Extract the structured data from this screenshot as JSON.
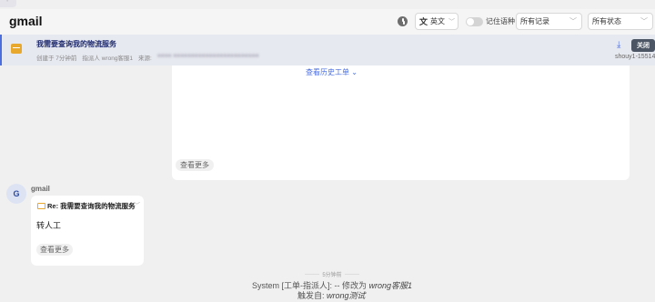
{
  "header": {
    "title": "gmail",
    "language": "英文",
    "remember_language_label": "记住语种",
    "records_filter": "所有记录",
    "status_filter": "所有状态"
  },
  "ticket": {
    "subject": "我需要查询我的物流服务",
    "created": "创建于 7分钟前",
    "assignee": "指派人 wrong客服1",
    "source_label": "来源:",
    "close_label": "关闭",
    "user_id": "shouy1-15514"
  },
  "thread": {
    "history_link": "查看历史工单",
    "view_more": "查看更多",
    "reply": {
      "avatar_letter": "G",
      "sender": "gmail",
      "subject": "Re: 我需要查询我的物流服务",
      "body": "转人工",
      "view_more": "查看更多"
    },
    "system_event": {
      "time": "5分钟前",
      "prefix": "System [工单-指派人]: --  修改为",
      "new_value": "wrong客服1",
      "trigger_prefix": "触发自:",
      "trigger_value": "wrong测试"
    }
  }
}
